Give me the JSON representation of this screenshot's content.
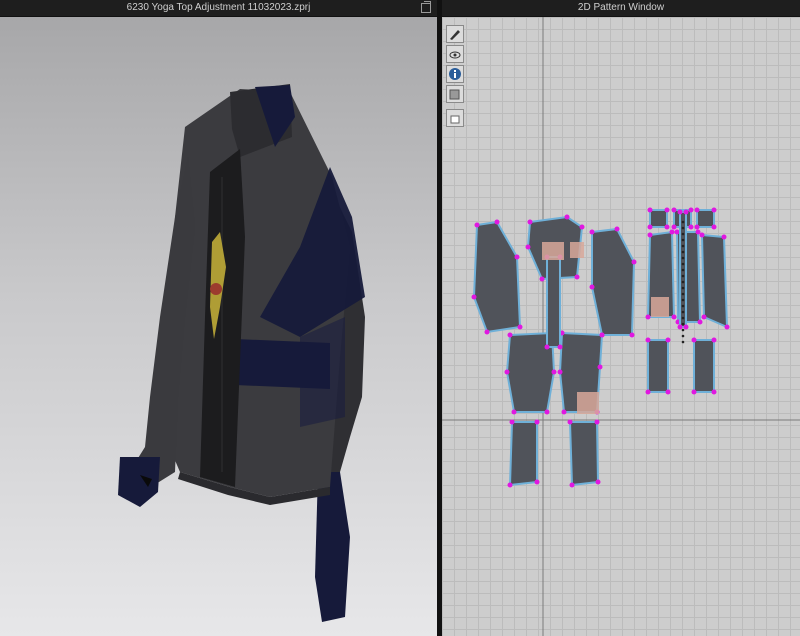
{
  "window": {
    "left_title": "6230 Yoga Top Adjustment 11032023.zprj",
    "right_title": "2D Pattern Window"
  },
  "pattern_toolbar": [
    {
      "icon": "brush-visibility-icon"
    },
    {
      "icon": "avatar-visibility-icon"
    },
    {
      "icon": "info-icon"
    },
    {
      "icon": "layer-icon"
    },
    {
      "icon": "garment-lock-icon"
    }
  ],
  "colors": {
    "garment_body": "#3b3b3f",
    "garment_panel": "#161a3a",
    "pattern_piece": "#50535a",
    "pattern_point": "#e018e0",
    "pattern_outline": "#6fb0d8",
    "pattern_seam": "#d8a89a",
    "grid_axis": "#7a7a7a"
  }
}
